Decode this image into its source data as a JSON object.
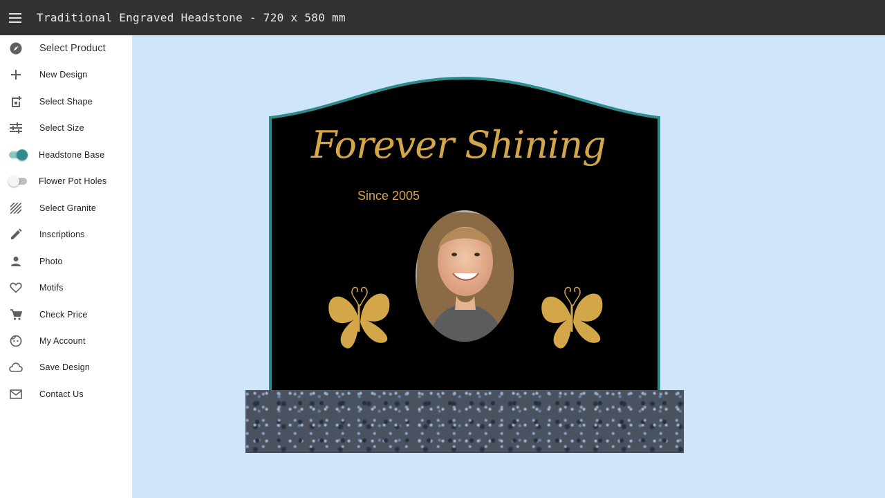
{
  "header": {
    "title": "Traditional Engraved Headstone - 720 x 580 mm",
    "menu_icon": "menu-icon"
  },
  "sidebar": {
    "items": [
      {
        "label": "Select Product",
        "icon": "compass-icon"
      },
      {
        "label": "New Design",
        "icon": "plus-icon"
      },
      {
        "label": "Select Shape",
        "icon": "add-shape-icon"
      },
      {
        "label": "Select Size",
        "icon": "sliders-icon"
      },
      {
        "label": "Headstone Base",
        "toggle": true,
        "on": true
      },
      {
        "label": "Flower Pot Holes",
        "toggle": true,
        "on": false
      },
      {
        "label": "Select Granite",
        "icon": "texture-icon"
      },
      {
        "label": "Inscriptions",
        "icon": "pencil-icon"
      },
      {
        "label": "Photo",
        "icon": "person-icon"
      },
      {
        "label": "Motifs",
        "icon": "heart-icon"
      },
      {
        "label": "Check Price",
        "icon": "cart-icon"
      },
      {
        "label": "My Account",
        "icon": "face-icon"
      },
      {
        "label": "Save Design",
        "icon": "cloud-icon"
      },
      {
        "label": "Contact Us",
        "icon": "mail-icon"
      }
    ]
  },
  "design": {
    "inscription_main": "Forever Shining",
    "inscription_sub": "Since 2005",
    "colors": {
      "background": "#cfe5f9",
      "stone": "#000000",
      "stone_border": "#2e8b8b",
      "engraving_gold": "#d4a64a",
      "topbar": "#323232",
      "toggle_accent": "#2e8b8b"
    },
    "motif_icon": "butterfly-icon",
    "photo_icon": "portrait-photo"
  }
}
